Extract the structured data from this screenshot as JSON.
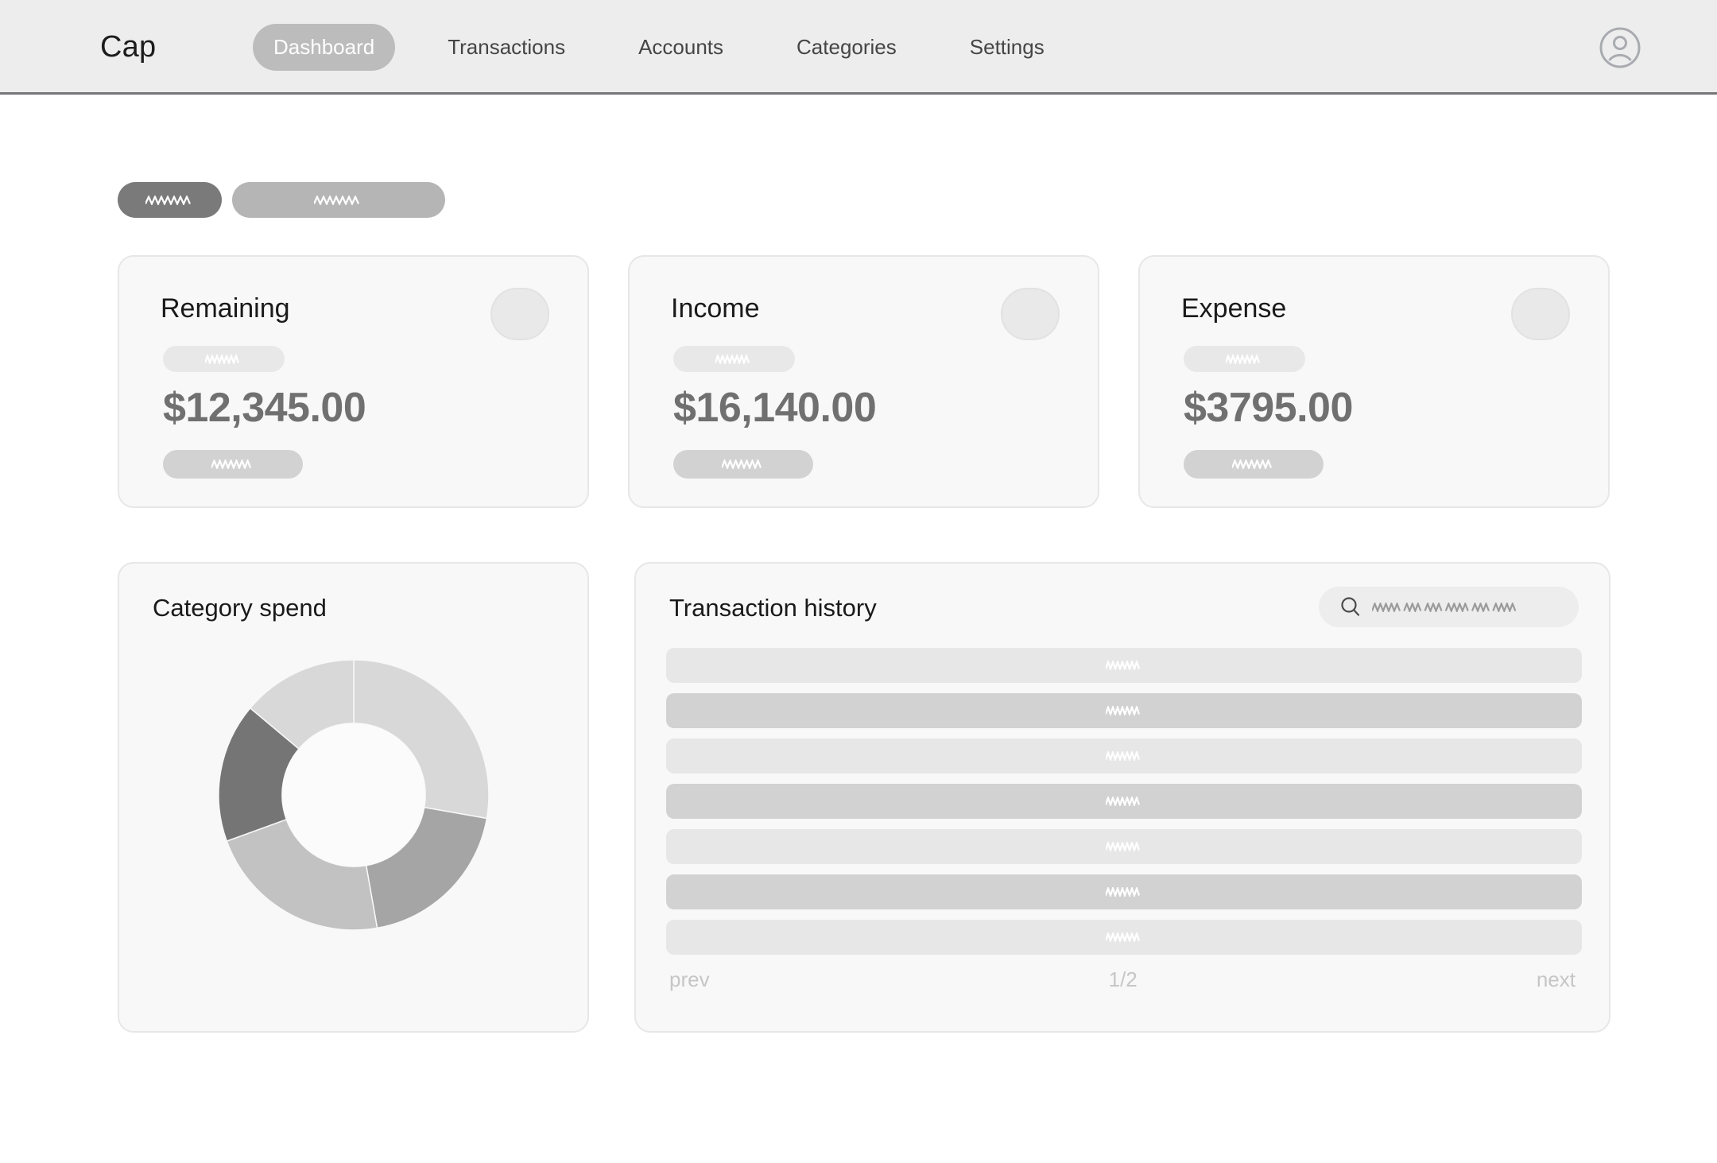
{
  "app": {
    "brand": "Cap",
    "header_bg": "#ededed",
    "accent": "#bcbcbc"
  },
  "header": {
    "nav": [
      {
        "label": "Dashboard",
        "active": true
      },
      {
        "label": "Transactions",
        "active": false
      },
      {
        "label": "Accounts",
        "active": false
      },
      {
        "label": "Categories",
        "active": false
      },
      {
        "label": "Settings",
        "active": false
      }
    ],
    "avatar_icon": "user-avatar-icon"
  },
  "toggles": [
    {
      "name": "range-toggle-primary",
      "placeholder_words": 1,
      "style": "primary",
      "color": "#7a7a7a"
    },
    {
      "name": "range-toggle-secondary",
      "placeholder_words": 1,
      "style": "secondary",
      "color": "#b5b5b5"
    }
  ],
  "stat_cards": [
    {
      "title": "Remaining",
      "amount": "$12,345.00",
      "badge_icon": "card-badge-placeholder-icon"
    },
    {
      "title": "Income",
      "amount": "$16,140.00",
      "badge_icon": "card-badge-placeholder-icon"
    },
    {
      "title": "Expense",
      "amount": "$3795.00",
      "badge_icon": "card-badge-placeholder-icon"
    }
  ],
  "category_spend": {
    "title": "Category spend"
  },
  "chart_data": {
    "type": "pie",
    "title": "Category spend",
    "subtitle": "",
    "variant": "donut",
    "inner_radius_ratio": 0.53,
    "start_angle_deg": 0,
    "direction": "clockwise",
    "legend": "none",
    "labels_shown": false,
    "categories": [
      "Segment 1",
      "Segment 2",
      "Segment 3",
      "Segment 4",
      "Segment 5"
    ],
    "values": [
      27.8,
      19.4,
      22.2,
      16.7,
      13.9
    ],
    "angles_deg": [
      100,
      70,
      80,
      60,
      50
    ],
    "colors": [
      "#d8d8d8",
      "#a5a5a5",
      "#c2c2c2",
      "#757575",
      "#d8d8d8"
    ]
  },
  "transaction_history": {
    "title": "Transaction history",
    "search": {
      "icon": "search-icon",
      "value": "",
      "placeholder_words": 6
    },
    "rows": [
      {
        "shade": "light",
        "placeholder_words": 1
      },
      {
        "shade": "dark",
        "placeholder_words": 1
      },
      {
        "shade": "light",
        "placeholder_words": 1
      },
      {
        "shade": "dark",
        "placeholder_words": 1
      },
      {
        "shade": "light",
        "placeholder_words": 1
      },
      {
        "shade": "dark",
        "placeholder_words": 1
      },
      {
        "shade": "light",
        "placeholder_words": 1
      }
    ],
    "pagination": {
      "prev_label": "prev",
      "page_indicator": "1/2",
      "next_label": "next"
    }
  }
}
